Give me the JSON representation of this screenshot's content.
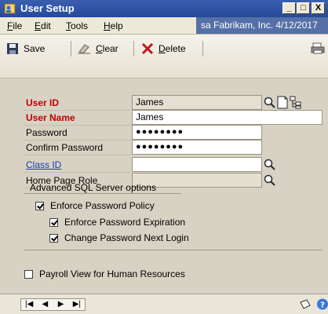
{
  "window": {
    "title": "User Setup",
    "minimize": "_",
    "maximize": "□",
    "close": "X"
  },
  "menu": {
    "items": [
      {
        "label": "File",
        "accel": "F",
        "rest": "ile"
      },
      {
        "label": "Edit",
        "accel": "E",
        "rest": "dit"
      },
      {
        "label": "Tools",
        "accel": "T",
        "rest": "ools"
      },
      {
        "label": "Help",
        "accel": "H",
        "rest": "elp"
      }
    ],
    "status": "sa  Fabrikam, Inc.  4/12/2017"
  },
  "toolbar": {
    "save_label": "Save",
    "clear_label": "Clear",
    "clear_accel": "C",
    "clear_rest": "lear",
    "delete_label": "Delete",
    "delete_accel": "D",
    "delete_rest": "elete"
  },
  "form": {
    "user_id": {
      "label": "User ID",
      "value": "James"
    },
    "user_name": {
      "label": "User Name",
      "value": "James"
    },
    "password": {
      "label": "Password",
      "value": "●●●●●●●●"
    },
    "confirm_password": {
      "label": "Confirm Password",
      "value": "●●●●●●●●"
    },
    "class_id": {
      "label": "Class ID",
      "value": ""
    },
    "home_page_role": {
      "label": "Home Page Role",
      "value": ""
    }
  },
  "sql_options": {
    "title": "Advanced SQL Server options",
    "enforce_policy": {
      "label": "Enforce Password Policy",
      "checked": true
    },
    "enforce_expiration": {
      "label": "Enforce Password Expiration",
      "checked": true
    },
    "change_next_login": {
      "label": "Change Password Next Login",
      "checked": true
    }
  },
  "payroll_view": {
    "label": "Payroll View for Human Resources",
    "checked": false
  },
  "statusbar": {
    "first": "|◀",
    "prev": "◀",
    "next": "▶",
    "last": "▶|"
  }
}
